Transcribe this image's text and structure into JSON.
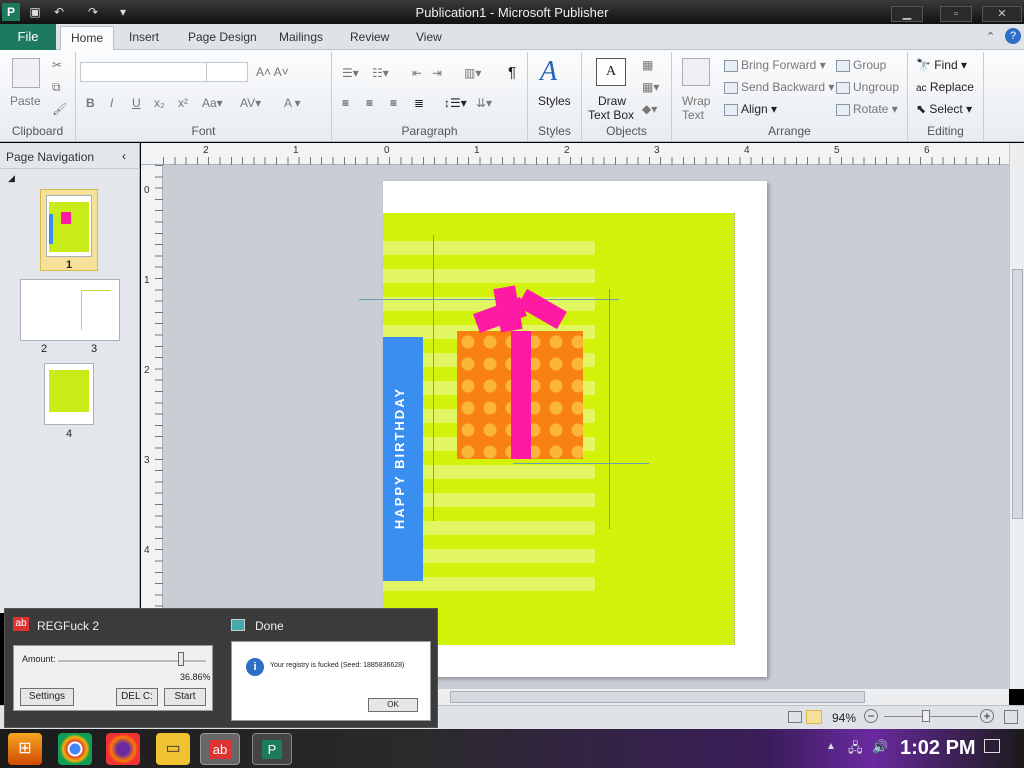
{
  "window": {
    "title": "Publication1 - Microsoft Publisher"
  },
  "tabs": [
    "Insert",
    "Page Design",
    "Mailings",
    "Review",
    "View"
  ],
  "tab_file": "File",
  "tab_home": "Home",
  "ribbon": {
    "clipboard": {
      "label": "Clipboard",
      "paste": "Paste"
    },
    "font": {
      "label": "Font"
    },
    "paragraph": {
      "label": "Paragraph"
    },
    "styles": {
      "label": "Styles",
      "button": "Styles"
    },
    "objects": {
      "label": "Objects",
      "draw_line1": "Draw",
      "draw_line2": "Text Box"
    },
    "arrange": {
      "label": "Arrange",
      "wrap_line1": "Wrap",
      "wrap_line2": "Text",
      "bring_forward": "Bring Forward",
      "send_backward": "Send Backward",
      "align": "Align",
      "group": "Group",
      "ungroup": "Ungroup",
      "rotate": "Rotate"
    },
    "editing": {
      "label": "Editing",
      "find": "Find",
      "replace": "Replace",
      "select": "Select"
    }
  },
  "page_navigation": {
    "title": "Page Navigation",
    "thumb_labels": [
      "1",
      "2",
      "3",
      "4"
    ]
  },
  "ruler": {
    "h": [
      "2",
      "1",
      "0",
      "1",
      "2",
      "3",
      "4",
      "5",
      "6"
    ],
    "v": [
      "0",
      "1",
      "2",
      "3",
      "4"
    ]
  },
  "card": {
    "text": "HAPPY BIRTHDAY",
    "bg": "#d2f20c",
    "stripe": "#3a8ef0",
    "ribbon": "#ff1aa6",
    "box": "#f98112"
  },
  "status": {
    "zoom": "94%"
  },
  "reg_tool": {
    "title": "REGFuck 2",
    "amount_label": "Amount:",
    "amount_value": "36.86%",
    "amount_fraction": 0.8686,
    "settings": "Settings",
    "del": "DEL C:",
    "start": "Start"
  },
  "done_dialog": {
    "title": "Done",
    "message": "Your registry is fucked (Seed: 1885836628)",
    "ok": "OK"
  },
  "taskbar": {
    "time": "1:02 PM"
  }
}
